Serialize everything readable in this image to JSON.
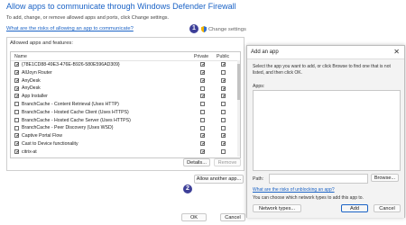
{
  "header": {
    "title": "Allow apps to communicate through Windows Defender Firewall",
    "subtitle": "To add, change, or remove allowed apps and ports, click Change settings.",
    "risks_link": "What are the risks of allowing an app to communicate?",
    "change_settings": "Change settings"
  },
  "markers": {
    "one": "1",
    "two": "2"
  },
  "allowed": {
    "group_label": "Allowed apps and features:",
    "columns": {
      "name": "Name",
      "private": "Private",
      "public": "Public"
    },
    "rows": [
      {
        "name": "{78E1CD88-49E3-476E-B926-580E596AD309}",
        "checked": true,
        "private": true,
        "public": true
      },
      {
        "name": "AllJoyn Router",
        "checked": true,
        "private": true,
        "public": false
      },
      {
        "name": "AnyDesk",
        "checked": true,
        "private": true,
        "public": true
      },
      {
        "name": "AnyDesk",
        "checked": true,
        "private": false,
        "public": true
      },
      {
        "name": "App Installer",
        "checked": true,
        "private": true,
        "public": true
      },
      {
        "name": "BranchCache - Content Retrieval (Uses HTTP)",
        "checked": false,
        "private": false,
        "public": false
      },
      {
        "name": "BranchCache - Hosted Cache Client (Uses HTTPS)",
        "checked": false,
        "private": false,
        "public": false
      },
      {
        "name": "BranchCache - Hosted Cache Server (Uses HTTPS)",
        "checked": false,
        "private": false,
        "public": false
      },
      {
        "name": "BranchCache - Peer Discovery (Uses WSD)",
        "checked": false,
        "private": false,
        "public": false
      },
      {
        "name": "Captive Portal Flow",
        "checked": true,
        "private": true,
        "public": true
      },
      {
        "name": "Cast to Device functionality",
        "checked": true,
        "private": true,
        "public": true
      },
      {
        "name": "citrix-at",
        "checked": true,
        "private": true,
        "public": false
      }
    ],
    "details_label": "Details...",
    "remove_label": "Remove",
    "allow_another_label": "Allow another app..."
  },
  "footer": {
    "ok_label": "OK",
    "cancel_label": "Cancel"
  },
  "dialog": {
    "title": "Add an app",
    "close": "✕",
    "description": "Select the app you want to add, or click Browse to find one that is not listed, and then click OK.",
    "apps_label": "Apps:",
    "path_label": "Path:",
    "browse_label": "Browse...",
    "unblock_link": "What are the risks of unblocking an app?",
    "network_note": "You can choose which network types to add this app to.",
    "network_types_label": "Network types...",
    "add_label": "Add",
    "cancel_label": "Cancel"
  },
  "colors": {
    "accent": "#1b63c6",
    "marker": "#3d3f98"
  }
}
